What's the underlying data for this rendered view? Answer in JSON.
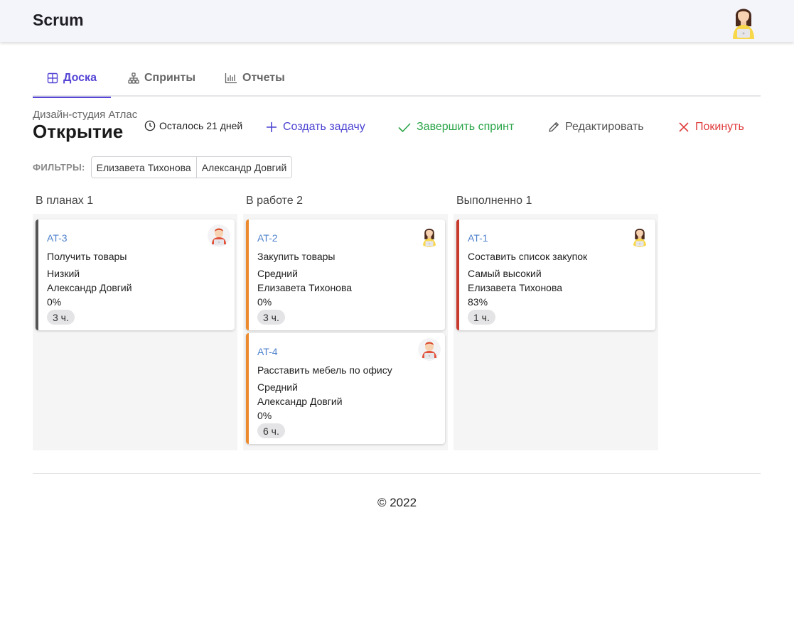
{
  "app": {
    "title": "Scrum"
  },
  "tabs": [
    {
      "label": "Доска",
      "icon": "board-icon",
      "active": true
    },
    {
      "label": "Спринты",
      "icon": "sprints-icon",
      "active": false
    },
    {
      "label": "Отчеты",
      "icon": "reports-icon",
      "active": false
    }
  ],
  "sprint": {
    "project": "Дизайн-студия Атлас",
    "title": "Открытие",
    "remaining": "Осталось 21 дней"
  },
  "actions": {
    "create": "Создать задачу",
    "finish": "Завершить спринт",
    "edit": "Редактировать",
    "leave": "Покинуть"
  },
  "filters": {
    "label": "ФИЛЬТРЫ:",
    "options": [
      "Елизавета Тихонова",
      "Александр Довгий"
    ]
  },
  "columns": [
    {
      "title": "В планах 1",
      "cards": [
        {
          "key": "AT-3",
          "title": "Получить товары",
          "priority": "Низкий",
          "assignee": "Александр Довгий",
          "progress": "0%",
          "estimate": "3 ч.",
          "avatar": "male-avatar"
        }
      ]
    },
    {
      "title": "В работе 2",
      "cards": [
        {
          "key": "AT-2",
          "title": "Закупить товары",
          "priority": "Средний",
          "assignee": "Елизавета Тихонова",
          "progress": "0%",
          "estimate": "3 ч.",
          "avatar": "female-avatar"
        },
        {
          "key": "AT-4",
          "title": "Расставить мебель по офису",
          "priority": "Средний",
          "assignee": "Александр Довгий",
          "progress": "0%",
          "estimate": "6 ч.",
          "avatar": "male-avatar"
        }
      ]
    },
    {
      "title": "Выполненно 1",
      "cards": [
        {
          "key": "AT-1",
          "title": "Составить список закупок",
          "priority": "Самый высокий",
          "assignee": "Елизавета Тихонова",
          "progress": "83%",
          "estimate": "1 ч.",
          "avatar": "female-avatar"
        }
      ]
    }
  ],
  "footer": {
    "copyright": "© 2022"
  },
  "colors": {
    "accent": "#5546d6",
    "success": "#29a447",
    "danger": "#e03c3c",
    "priority_low": "#555555",
    "priority_medium": "#ec8a2f",
    "priority_highest": "#c8392e",
    "link": "#4f82cc"
  }
}
